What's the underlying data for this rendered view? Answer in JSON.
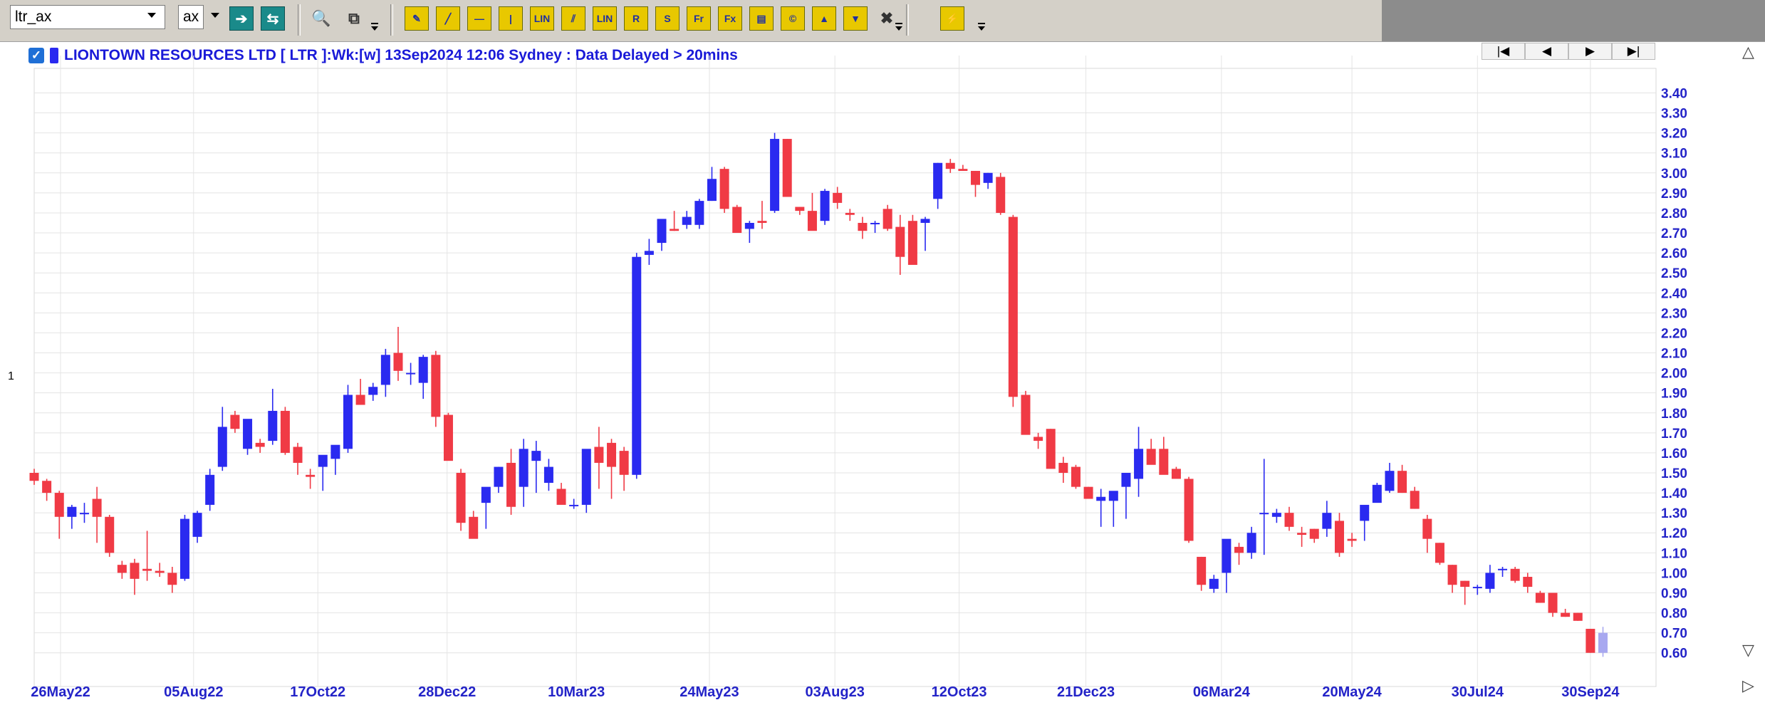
{
  "toolbar": {
    "symbol_value": "ltr_ax",
    "exchange_value": "ax",
    "buttons": [
      {
        "name": "go-icon",
        "glyph": "➔",
        "style": "teal"
      },
      {
        "name": "refresh-icon",
        "glyph": "⇆",
        "style": "teal"
      },
      {
        "name": "binoculars-icon",
        "glyph": "🔍",
        "style": "plain"
      },
      {
        "name": "compare-icon",
        "glyph": "⧉",
        "style": "plain"
      },
      {
        "name": "draw-tool-icon",
        "glyph": "✎",
        "style": "yellow"
      },
      {
        "name": "trendline-icon",
        "glyph": "╱",
        "style": "yellow"
      },
      {
        "name": "horizontal-line-icon",
        "glyph": "—",
        "style": "yellow"
      },
      {
        "name": "vertical-line-icon",
        "glyph": "|",
        "style": "yellow"
      },
      {
        "name": "lin-tool-icon",
        "glyph": "LIN",
        "style": "yellow"
      },
      {
        "name": "parallel-lines-icon",
        "glyph": "⫽",
        "style": "yellow"
      },
      {
        "name": "lin-channel-icon",
        "glyph": "LIN",
        "style": "yellow"
      },
      {
        "name": "resistance-icon",
        "glyph": "R",
        "style": "yellow"
      },
      {
        "name": "support-icon",
        "glyph": "S",
        "style": "yellow"
      },
      {
        "name": "fibonacci-icon",
        "glyph": "Fr",
        "style": "yellow"
      },
      {
        "name": "fib-extension-icon",
        "glyph": "Fx",
        "style": "yellow"
      },
      {
        "name": "note-icon",
        "glyph": "▤",
        "style": "yellow"
      },
      {
        "name": "label-icon",
        "glyph": "©",
        "style": "yellow"
      },
      {
        "name": "up-arrow-icon",
        "glyph": "▲",
        "style": "yellow"
      },
      {
        "name": "down-arrow-icon",
        "glyph": "▼",
        "style": "yellow"
      },
      {
        "name": "delete-icon",
        "glyph": "✖",
        "style": "plain"
      },
      {
        "name": "magic-tool-icon",
        "glyph": "⚡",
        "style": "yellow"
      }
    ]
  },
  "chart": {
    "title": "LIONTOWN RESOURCES LTD [ LTR ]:Wk:[w]  13Sep2024 12:06 Sydney : Data Delayed > 20mins",
    "panel_label": "1",
    "nav_buttons": [
      "|◀",
      "◀",
      "▶",
      "▶|"
    ]
  },
  "chart_data": {
    "type": "candlestick",
    "interval": "weekly",
    "up_color": "#2a2af0",
    "down_color": "#f03a45",
    "current_color": "#a8a8f0",
    "grid": true,
    "y_axis_position": "right",
    "ylim": [
      0.51,
      3.48
    ],
    "y_ticks": [
      "0.60",
      "0.70",
      "0.80",
      "0.90",
      "1.00",
      "1.10",
      "1.20",
      "1.30",
      "1.40",
      "1.50",
      "1.60",
      "1.70",
      "1.80",
      "1.90",
      "2.00",
      "2.10",
      "2.20",
      "2.30",
      "2.40",
      "2.50",
      "2.60",
      "2.70",
      "2.80",
      "2.90",
      "3.00",
      "3.10",
      "3.20",
      "3.30",
      "3.40"
    ],
    "x_ticks": [
      {
        "label": "26May22",
        "index": 2.1
      },
      {
        "label": "05Aug22",
        "index": 12.7
      },
      {
        "label": "17Oct22",
        "index": 22.6
      },
      {
        "label": "28Dec22",
        "index": 32.9
      },
      {
        "label": "10Mar23",
        "index": 43.2
      },
      {
        "label": "24May23",
        "index": 53.8
      },
      {
        "label": "03Aug23",
        "index": 63.8
      },
      {
        "label": "12Oct23",
        "index": 73.7
      },
      {
        "label": "21Dec23",
        "index": 83.8
      },
      {
        "label": "06Mar24",
        "index": 94.6
      },
      {
        "label": "20May24",
        "index": 105.0
      },
      {
        "label": "30Jul24",
        "index": 115.0
      },
      {
        "label": "30Sep24",
        "index": 124.0
      }
    ],
    "candles": [
      [
        1.5,
        1.52,
        1.44,
        1.46
      ],
      [
        1.46,
        1.47,
        1.36,
        1.4
      ],
      [
        1.4,
        1.41,
        1.17,
        1.28
      ],
      [
        1.28,
        1.34,
        1.22,
        1.33
      ],
      [
        1.3,
        1.35,
        1.25,
        1.3
      ],
      [
        1.37,
        1.43,
        1.15,
        1.28
      ],
      [
        1.28,
        1.29,
        1.08,
        1.1
      ],
      [
        1.04,
        1.06,
        0.97,
        1.0
      ],
      [
        1.05,
        1.07,
        0.89,
        0.97
      ],
      [
        1.02,
        1.21,
        0.96,
        1.01
      ],
      [
        1.01,
        1.05,
        0.98,
        1.0
      ],
      [
        1.0,
        1.03,
        0.9,
        0.94
      ],
      [
        0.97,
        1.29,
        0.96,
        1.27
      ],
      [
        1.18,
        1.31,
        1.15,
        1.3
      ],
      [
        1.34,
        1.52,
        1.31,
        1.49
      ],
      [
        1.53,
        1.83,
        1.51,
        1.73
      ],
      [
        1.79,
        1.81,
        1.7,
        1.72
      ],
      [
        1.62,
        1.72,
        1.59,
        1.77
      ],
      [
        1.65,
        1.67,
        1.6,
        1.63
      ],
      [
        1.66,
        1.92,
        1.64,
        1.81
      ],
      [
        1.81,
        1.83,
        1.59,
        1.6
      ],
      [
        1.63,
        1.65,
        1.49,
        1.55
      ],
      [
        1.49,
        1.52,
        1.42,
        1.48
      ],
      [
        1.53,
        1.58,
        1.41,
        1.59
      ],
      [
        1.57,
        1.61,
        1.49,
        1.64
      ],
      [
        1.62,
        1.94,
        1.6,
        1.89
      ],
      [
        1.89,
        1.97,
        1.84,
        1.84
      ],
      [
        1.89,
        1.95,
        1.86,
        1.93
      ],
      [
        1.94,
        2.12,
        1.88,
        2.09
      ],
      [
        2.1,
        2.23,
        1.96,
        2.01
      ],
      [
        2.0,
        2.05,
        1.94,
        2.0
      ],
      [
        1.95,
        2.09,
        1.87,
        2.08
      ],
      [
        2.09,
        2.11,
        1.73,
        1.78
      ],
      [
        1.79,
        1.8,
        1.57,
        1.56
      ],
      [
        1.5,
        1.52,
        1.21,
        1.25
      ],
      [
        1.28,
        1.31,
        1.21,
        1.17
      ],
      [
        1.35,
        1.42,
        1.22,
        1.43
      ],
      [
        1.43,
        1.53,
        1.4,
        1.53
      ],
      [
        1.55,
        1.62,
        1.29,
        1.33
      ],
      [
        1.43,
        1.67,
        1.33,
        1.62
      ],
      [
        1.56,
        1.66,
        1.4,
        1.61
      ],
      [
        1.45,
        1.57,
        1.41,
        1.53
      ],
      [
        1.42,
        1.45,
        1.35,
        1.34
      ],
      [
        1.34,
        1.37,
        1.32,
        1.34
      ],
      [
        1.34,
        1.4,
        1.3,
        1.62
      ],
      [
        1.63,
        1.73,
        1.42,
        1.55
      ],
      [
        1.65,
        1.67,
        1.37,
        1.53
      ],
      [
        1.61,
        1.63,
        1.41,
        1.49
      ],
      [
        1.49,
        2.6,
        1.47,
        2.58
      ],
      [
        2.59,
        2.67,
        2.54,
        2.61
      ],
      [
        2.65,
        2.75,
        2.61,
        2.77
      ],
      [
        2.72,
        2.81,
        2.71,
        2.71
      ],
      [
        2.74,
        2.81,
        2.72,
        2.78
      ],
      [
        2.74,
        2.87,
        2.72,
        2.86
      ],
      [
        2.86,
        3.03,
        2.86,
        2.97
      ],
      [
        3.02,
        3.03,
        2.8,
        2.82
      ],
      [
        2.83,
        2.84,
        2.72,
        2.7
      ],
      [
        2.72,
        2.76,
        2.65,
        2.75
      ],
      [
        2.76,
        2.86,
        2.72,
        2.75
      ],
      [
        2.81,
        3.2,
        2.8,
        3.17
      ],
      [
        3.17,
        3.17,
        2.89,
        2.88
      ],
      [
        2.83,
        2.83,
        2.79,
        2.81
      ],
      [
        2.81,
        2.9,
        2.72,
        2.71
      ],
      [
        2.76,
        2.92,
        2.74,
        2.91
      ],
      [
        2.9,
        2.93,
        2.82,
        2.85
      ],
      [
        2.8,
        2.82,
        2.76,
        2.79
      ],
      [
        2.75,
        2.78,
        2.67,
        2.71
      ],
      [
        2.75,
        2.76,
        2.7,
        2.75
      ],
      [
        2.82,
        2.84,
        2.71,
        2.72
      ],
      [
        2.73,
        2.79,
        2.49,
        2.58
      ],
      [
        2.76,
        2.79,
        2.55,
        2.54
      ],
      [
        2.75,
        2.78,
        2.61,
        2.77
      ],
      [
        2.87,
        3.05,
        2.82,
        3.05
      ],
      [
        3.05,
        3.07,
        3.0,
        3.02
      ],
      [
        3.02,
        3.04,
        3.01,
        3.01
      ],
      [
        3.01,
        3.01,
        2.88,
        2.94
      ],
      [
        2.95,
        3.0,
        2.92,
        3.0
      ],
      [
        2.98,
        3.0,
        2.79,
        2.8
      ],
      [
        2.78,
        2.79,
        1.83,
        1.88
      ],
      [
        1.89,
        1.91,
        1.7,
        1.69
      ],
      [
        1.68,
        1.7,
        1.62,
        1.66
      ],
      [
        1.72,
        1.72,
        1.53,
        1.52
      ],
      [
        1.55,
        1.58,
        1.45,
        1.5
      ],
      [
        1.53,
        1.54,
        1.42,
        1.43
      ],
      [
        1.43,
        1.43,
        1.38,
        1.37
      ],
      [
        1.36,
        1.42,
        1.23,
        1.38
      ],
      [
        1.36,
        1.4,
        1.23,
        1.41
      ],
      [
        1.43,
        1.48,
        1.27,
        1.5
      ],
      [
        1.47,
        1.73,
        1.38,
        1.62
      ],
      [
        1.62,
        1.67,
        1.55,
        1.54
      ],
      [
        1.62,
        1.68,
        1.52,
        1.49
      ],
      [
        1.52,
        1.53,
        1.48,
        1.47
      ],
      [
        1.47,
        1.48,
        1.15,
        1.16
      ],
      [
        1.08,
        1.08,
        0.91,
        0.94
      ],
      [
        0.92,
        0.99,
        0.9,
        0.97
      ],
      [
        1.0,
        1.15,
        0.9,
        1.17
      ],
      [
        1.13,
        1.15,
        1.04,
        1.1
      ],
      [
        1.1,
        1.23,
        1.07,
        1.2
      ],
      [
        1.3,
        1.57,
        1.09,
        1.3
      ],
      [
        1.28,
        1.32,
        1.25,
        1.3
      ],
      [
        1.3,
        1.33,
        1.21,
        1.23
      ],
      [
        1.2,
        1.23,
        1.13,
        1.19
      ],
      [
        1.22,
        1.22,
        1.15,
        1.17
      ],
      [
        1.22,
        1.36,
        1.18,
        1.3
      ],
      [
        1.26,
        1.3,
        1.08,
        1.1
      ],
      [
        1.17,
        1.2,
        1.13,
        1.16
      ],
      [
        1.26,
        1.28,
        1.16,
        1.34
      ],
      [
        1.35,
        1.45,
        1.38,
        1.44
      ],
      [
        1.41,
        1.55,
        1.4,
        1.51
      ],
      [
        1.51,
        1.54,
        1.4,
        1.4
      ],
      [
        1.41,
        1.43,
        1.32,
        1.32
      ],
      [
        1.27,
        1.29,
        1.1,
        1.17
      ],
      [
        1.15,
        1.15,
        1.04,
        1.05
      ],
      [
        1.04,
        1.04,
        0.9,
        0.94
      ],
      [
        0.96,
        0.96,
        0.84,
        0.93
      ],
      [
        0.93,
        0.94,
        0.89,
        0.93
      ],
      [
        0.92,
        1.04,
        0.9,
        1.0
      ],
      [
        1.02,
        1.03,
        0.98,
        1.02
      ],
      [
        1.02,
        1.03,
        0.95,
        0.96
      ],
      [
        0.98,
        1.0,
        0.9,
        0.93
      ],
      [
        0.9,
        0.91,
        0.85,
        0.85
      ],
      [
        0.9,
        0.9,
        0.78,
        0.8
      ],
      [
        0.8,
        0.82,
        0.78,
        0.78
      ],
      [
        0.8,
        0.8,
        0.76,
        0.76
      ],
      [
        0.72,
        0.72,
        0.6,
        0.6
      ],
      [
        0.6,
        0.73,
        0.58,
        0.7
      ]
    ]
  }
}
